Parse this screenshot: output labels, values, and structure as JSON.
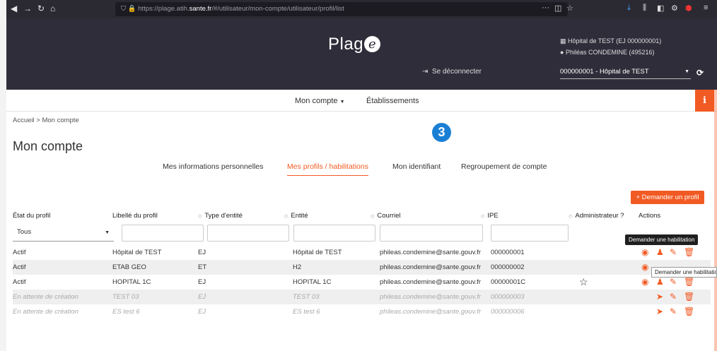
{
  "browser": {
    "url_prefix": "https://plage.atih.",
    "url_domain": "sante.fr",
    "url_path": "/#/utilisateur/mon-compte/utilisateur/profil/list"
  },
  "header": {
    "logo_text": "Plag",
    "logo_letter": "e",
    "logout": "Se déconnecter",
    "hospital": "Hôpital de TEST (EJ 000000001)",
    "user": "Philéas CONDEMINE (495216)",
    "selected_site": "000000001 - Hôpital de TEST"
  },
  "nav": {
    "account": "Mon compte",
    "establishments": "Établissements"
  },
  "breadcrumb": "Accueil  >  Mon compte",
  "page_title": "Mon compte",
  "step_number": "3",
  "tabs": [
    {
      "label": "Mes informations personnelles"
    },
    {
      "label": "Mes profils / habilitations"
    },
    {
      "label": "Mon identifiant"
    },
    {
      "label": "Regroupement de compte"
    }
  ],
  "request_profile_button": "+ Demander un profil",
  "columns": [
    "État du profil",
    "Libellé du profil",
    "Type d'entité",
    "Entité",
    "Courriel",
    "IPE",
    "Administrateur ?",
    "Actions"
  ],
  "filter_state": "Tous",
  "rows": [
    {
      "state": "Actif",
      "label": "Hôpital de TEST",
      "type": "EJ",
      "entity": "Hôpital de TEST",
      "email": "phileas.condemine@sante.gouv.fr",
      "ipe": "000000001"
    },
    {
      "state": "Actif",
      "label": "ETAB GEO",
      "type": "ET",
      "entity": "H2",
      "email": "phileas.condemine@sante.gouv.fr",
      "ipe": "000000002"
    },
    {
      "state": "Actif",
      "label": "HOPITAL 1C",
      "type": "EJ",
      "entity": "HOPITAL 1C",
      "email": "phileas.condemine@sante.gouv.fr",
      "ipe": "00000001C"
    },
    {
      "state": "En attente de création",
      "label": "TEST 03",
      "type": "EJ",
      "entity": "TEST 03",
      "email": "phileas.condemine@sante.gouv.fr",
      "ipe": "000000003"
    },
    {
      "state": "En attente de création",
      "label": "ES test 6",
      "type": "EJ",
      "entity": "ES test 6",
      "email": "phileas.condemine@sante.gouv.fr",
      "ipe": "000000006"
    }
  ],
  "tooltip_text": "Demander une habilitation",
  "tooltip2_text": "Demander une habilitation",
  "colors": {
    "accent": "#f25a23",
    "header": "#302d3b",
    "badge": "#1a7fd4"
  }
}
